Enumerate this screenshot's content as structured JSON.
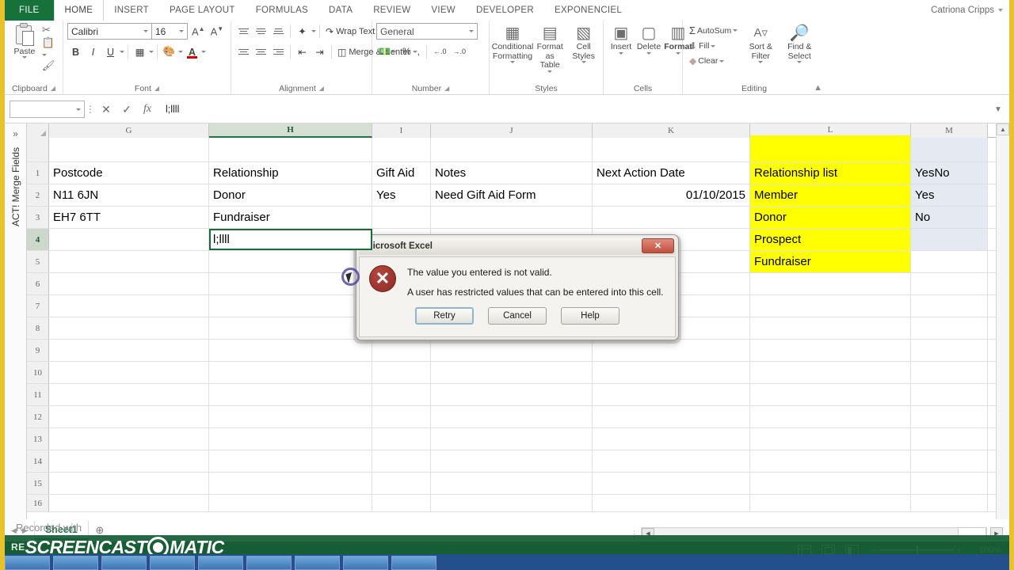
{
  "window": {
    "user_name": "Catriona Cripps",
    "ribbon_tabs": [
      "FILE",
      "HOME",
      "INSERT",
      "PAGE LAYOUT",
      "FORMULAS",
      "DATA",
      "REVIEW",
      "VIEW",
      "DEVELOPER",
      "EXPONENCIEL"
    ],
    "active_tab": "HOME"
  },
  "ribbon": {
    "clipboard": {
      "label": "Clipboard",
      "paste_label": "Paste",
      "cut_icon": "scissors-icon",
      "copy_icon": "copy-icon",
      "format_painter_icon": "format-painter-icon"
    },
    "font": {
      "label": "Font",
      "font_name": "Calibri",
      "font_size": "16",
      "bold": "B",
      "italic": "I",
      "underline": "U",
      "borders_icon": "borders-icon",
      "fill_color_icon": "fill-color-icon",
      "font_color_icon": "font-color-icon",
      "grow_font": "A",
      "shrink_font": "A"
    },
    "alignment": {
      "label": "Alignment",
      "wrap_text": "Wrap Text",
      "merge_center": "Merge & Center",
      "orientation_icon": "orientation-icon",
      "decrease_indent_icon": "decrease-indent-icon",
      "increase_indent_icon": "increase-indent-icon"
    },
    "number": {
      "label": "Number",
      "format": "General",
      "accounting_icon": "accounting-format-icon",
      "percent": "%",
      "comma": ",",
      "increase_decimal": "←.0",
      "decrease_decimal": "→.0"
    },
    "styles": {
      "label": "Styles",
      "conditional_formatting": "Conditional Formatting",
      "format_as_table": "Format as Table",
      "cell_styles": "Cell Styles"
    },
    "cells": {
      "label": "Cells",
      "insert": "Insert",
      "delete": "Delete",
      "format": "Format"
    },
    "editing": {
      "label": "Editing",
      "autosum": "AutoSum",
      "fill": "Fill",
      "clear": "Clear",
      "sort_filter": "Sort & Filter",
      "find_select": "Find & Select"
    }
  },
  "formula_bar": {
    "name_box": "",
    "cancel_icon": "cancel-x-icon",
    "enter_icon": "enter-check-icon",
    "function_icon": "insert-function-fx-icon",
    "value": "l;llll"
  },
  "task_pane": {
    "title": "ACT! Merge Fields",
    "expand_icon": "chevron-double-right-icon"
  },
  "grid": {
    "columns": [
      "G",
      "H",
      "I",
      "J",
      "K",
      "L",
      "M"
    ],
    "selected_column": "H",
    "selected_row": "4",
    "row_numbers": [
      "1",
      "2",
      "3",
      "4",
      "5",
      "6",
      "7",
      "8",
      "9",
      "10",
      "11",
      "12",
      "13",
      "14",
      "15",
      "16"
    ],
    "rows": [
      {
        "num": "1",
        "G": "Postcode",
        "H": "Relationship",
        "I": "Gift Aid",
        "J": "Notes",
        "K": "Next Action Date",
        "L": "Relationship list",
        "M": "YesNo"
      },
      {
        "num": "2",
        "G": "N11 6JN",
        "H": "Donor",
        "I": "Yes",
        "J": "Need Gift Aid Form",
        "K": "01/10/2015",
        "L": "Member",
        "M": "Yes"
      },
      {
        "num": "3",
        "G": "EH7 6TT",
        "H": "Fundraiser",
        "I": "",
        "J": "",
        "K": "",
        "L": "Donor",
        "M": "No"
      },
      {
        "num": "4",
        "G": "",
        "H": "l;llll",
        "I": "",
        "J": "",
        "K": "",
        "L": "Prospect",
        "M": ""
      },
      {
        "num": "5",
        "G": "",
        "H": "",
        "I": "",
        "J": "",
        "K": "",
        "L": "Fundraiser",
        "M": ""
      },
      {
        "num": "6",
        "G": "",
        "H": "",
        "I": "",
        "J": "",
        "K": "",
        "L": "",
        "M": ""
      },
      {
        "num": "7",
        "G": "",
        "H": "",
        "I": "",
        "J": "",
        "K": "",
        "L": "",
        "M": ""
      },
      {
        "num": "8",
        "G": "",
        "H": "",
        "I": "",
        "J": "",
        "K": "",
        "L": "",
        "M": ""
      },
      {
        "num": "9",
        "G": "",
        "H": "",
        "I": "",
        "J": "",
        "K": "",
        "L": "",
        "M": ""
      },
      {
        "num": "10",
        "G": "",
        "H": "",
        "I": "",
        "J": "",
        "K": "",
        "L": "",
        "M": ""
      },
      {
        "num": "11",
        "G": "",
        "H": "",
        "I": "",
        "J": "",
        "K": "",
        "L": "",
        "M": ""
      },
      {
        "num": "12",
        "G": "",
        "H": "",
        "I": "",
        "J": "",
        "K": "",
        "L": "",
        "M": ""
      },
      {
        "num": "13",
        "G": "",
        "H": "",
        "I": "",
        "J": "",
        "K": "",
        "L": "",
        "M": ""
      },
      {
        "num": "14",
        "G": "",
        "H": "",
        "I": "",
        "J": "",
        "K": "",
        "L": "",
        "M": ""
      },
      {
        "num": "15",
        "G": "",
        "H": "",
        "I": "",
        "J": "",
        "K": "",
        "L": "",
        "M": ""
      },
      {
        "num": "16",
        "G": "",
        "H": "",
        "I": "",
        "J": "",
        "K": "",
        "L": "",
        "M": ""
      }
    ],
    "highlight_colors": {
      "list_fill": "#ffff00",
      "yesno_fill": "#e4e9f2",
      "accent": "#217346"
    }
  },
  "dialog": {
    "title": "Microsoft Excel",
    "close_label": "✕",
    "icon": "error-x-icon",
    "message_line1": "The value you entered is not valid.",
    "message_line2": "A user has restricted values that can be entered into this cell.",
    "buttons": [
      {
        "label": "Retry",
        "default": true
      },
      {
        "label": "Cancel",
        "default": false
      },
      {
        "label": "Help",
        "default": false
      }
    ]
  },
  "sheet_bar": {
    "sheet_name": "Sheet1",
    "new_sheet_icon": "plus-circle-icon"
  },
  "status_bar": {
    "status_text": "RE",
    "zoom_level": "100%",
    "view_normal": "normal-view-icon",
    "view_layout": "page-layout-view-icon",
    "view_pagebreak": "page-break-view-icon"
  },
  "watermark": {
    "prefix": "RE",
    "text_left": "SCREENCAST",
    "text_right": "MATIC",
    "recorded_with": "Recorded with"
  }
}
